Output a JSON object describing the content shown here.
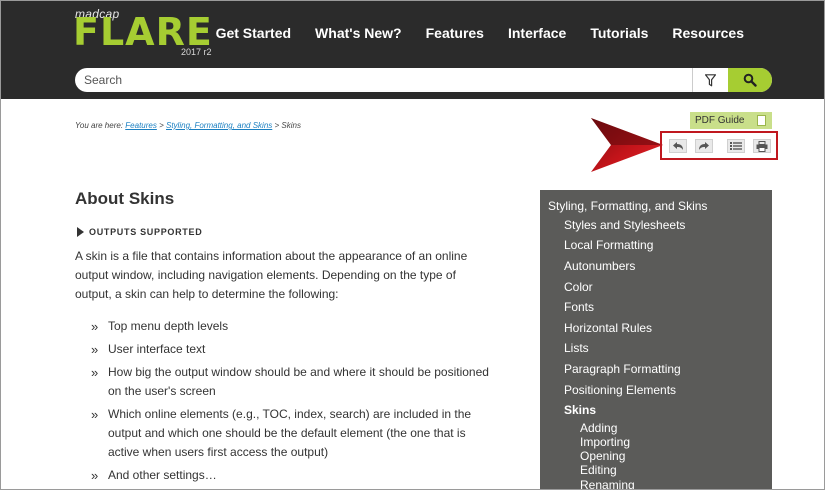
{
  "brand": {
    "company": "madcap",
    "product": "FLARE",
    "version": "2017 r2"
  },
  "nav": [
    "Get Started",
    "What's New?",
    "Features",
    "Interface",
    "Tutorials",
    "Resources"
  ],
  "search": {
    "placeholder": "Search"
  },
  "breadcrumb": {
    "prefix": "You are here:",
    "links": [
      "Features",
      "Styling, Formatting, and Skins"
    ],
    "separator": ">",
    "current": "Skins"
  },
  "pdf_guide": {
    "label": "PDF Guide"
  },
  "toolbar": {
    "icons": [
      "back-icon",
      "forward-icon",
      "list-icon",
      "print-icon"
    ]
  },
  "content": {
    "title": "About Skins",
    "outputs_label": "OUTPUTS SUPPORTED",
    "intro": "A skin is a file that contains information about the appearance of an online output window, including navigation elements. Depending on the type of output, a skin can help to determine the following:",
    "bullet_mark": "»",
    "bullets": [
      "Top menu depth levels",
      "User interface text",
      "How big the output window should be and where it should be positioned on the user's screen",
      "Which online elements (e.g., TOC, index, search) are included in the output and which one should be the default element (the one that is active when users first access the output)",
      "And other settings…"
    ]
  },
  "sidenav": {
    "root": "Styling, Formatting, and Skins",
    "items": [
      "Styles and Stylesheets",
      "Local Formatting",
      "Autonumbers",
      "Color",
      "Fonts",
      "Horizontal Rules",
      "Lists",
      "Paragraph Formatting",
      "Positioning Elements",
      "Skins"
    ],
    "active": "Skins",
    "subitems": [
      "Adding",
      "Importing",
      "Opening",
      "Editing",
      "Renaming"
    ]
  },
  "colors": {
    "header_bg": "#2b2b2b",
    "accent": "#a6cd32",
    "sidenav_bg": "#5b5b59",
    "highlight": "#c0181f",
    "link": "#1a7fc1"
  }
}
